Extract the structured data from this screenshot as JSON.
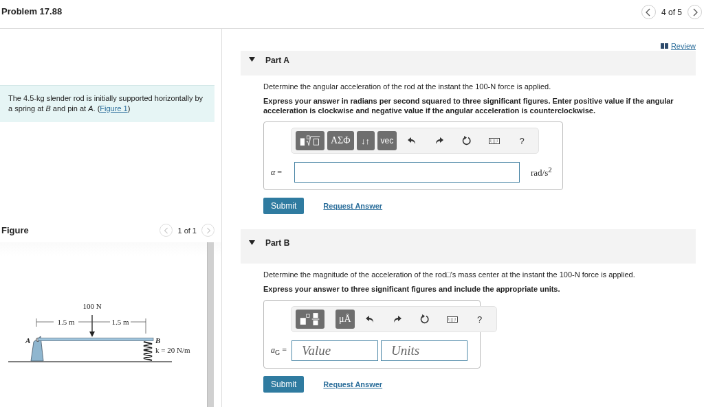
{
  "header": {
    "title": "Problem 17.88",
    "pager": "4 of 5"
  },
  "intro": {
    "text": "The 4.5-kg slender rod is initially supported horizontally by a spring at *B* and pin at *A*. (",
    "link": "Figure 1",
    "after": ")"
  },
  "figure": {
    "title": "Figure",
    "pager": "1 of 1",
    "labels": {
      "force": "100 N",
      "dim_left": "1.5 m",
      "dim_right": "1.5 m",
      "point_a": "A",
      "point_b": "B",
      "spring": "k = 20 N/m"
    }
  },
  "review": "Review",
  "parts": [
    {
      "label": "Part A",
      "expanded": true,
      "prompt": "Determine the angular acceleration of the rod at the instant the 100-N force is applied.",
      "instruction": "Express your answer in radians per second squared to three significant figures. Enter positive value if the angular acceleration is clockwise and negative value if the angular acceleration is counterclockwise.",
      "toolbar": [
        {
          "kind": "template-root"
        },
        {
          "kind": "greek",
          "label": "ΑΣΦ"
        },
        {
          "kind": "arrows",
          "label": "↓↑"
        },
        {
          "kind": "vec",
          "label": "vec"
        },
        {
          "kind": "undo"
        },
        {
          "kind": "redo"
        },
        {
          "kind": "reset"
        },
        {
          "kind": "keyboard"
        },
        {
          "kind": "help",
          "label": "?"
        }
      ],
      "answer_label": "*α* =",
      "fields": [
        {
          "kind": "wide"
        }
      ],
      "units": "rad/s$^{2}$",
      "submit": "Submit",
      "request": "Request Answer"
    },
    {
      "label": "Part B",
      "expanded": true,
      "prompt": "Determine the magnitude of the acceleration of the rod□'s mass center at the instant the 100-N force is applied.",
      "instruction": "Express your answer to three significant figures and include the appropriate units.",
      "toolbar": [
        {
          "kind": "template-frac"
        },
        {
          "kind": "units",
          "label": "μÅ"
        },
        {
          "kind": "undo"
        },
        {
          "kind": "redo"
        },
        {
          "kind": "reset"
        },
        {
          "kind": "keyboard"
        },
        {
          "kind": "help",
          "label": "?"
        }
      ],
      "answer_label": "*a*$_{G}$ =",
      "fields": [
        {
          "kind": "value",
          "placeholder": "Value"
        },
        {
          "kind": "units",
          "placeholder": "Units"
        }
      ],
      "submit": "Submit",
      "request": "Request Answer"
    }
  ]
}
